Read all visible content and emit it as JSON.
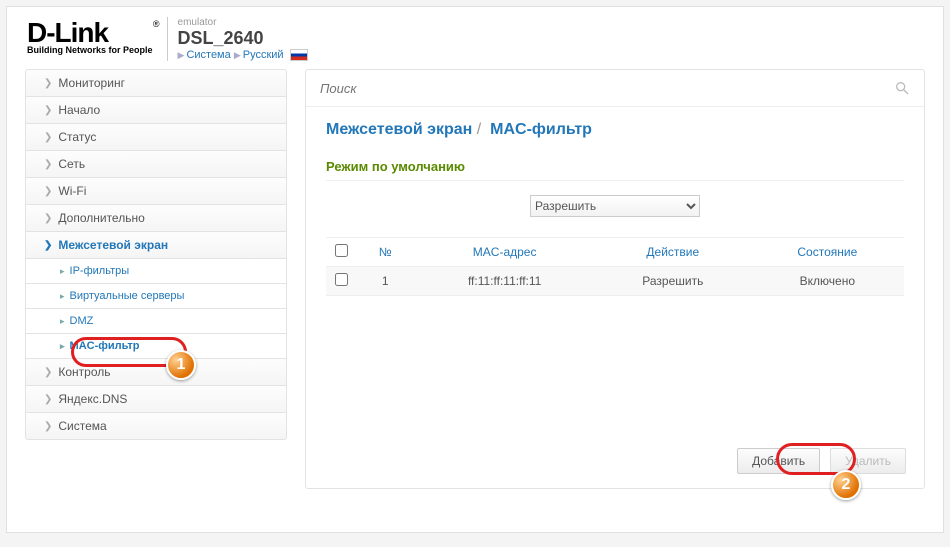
{
  "header": {
    "brand": "D-Link",
    "tagline": "Building Networks for People",
    "emulator": "emulator",
    "model": "DSL_2640",
    "crumb1": "Система",
    "crumb2": "Русский"
  },
  "sidebar": {
    "items": [
      {
        "label": "Мониторинг"
      },
      {
        "label": "Начало"
      },
      {
        "label": "Статус"
      },
      {
        "label": "Сеть"
      },
      {
        "label": "Wi-Fi"
      },
      {
        "label": "Дополнительно"
      },
      {
        "label": "Межсетевой экран",
        "expanded": true
      },
      {
        "label": "Контроль"
      },
      {
        "label": "Яндекс.DNS"
      },
      {
        "label": "Система"
      }
    ],
    "sub": [
      {
        "label": "IP-фильтры"
      },
      {
        "label": "Виртуальные серверы"
      },
      {
        "label": "DMZ"
      },
      {
        "label": "MAC-фильтр",
        "active": true
      }
    ]
  },
  "search": {
    "placeholder": "Поиск"
  },
  "title": {
    "crumb": "Межсетевой экран",
    "sep": "/",
    "page": "MAC-фильтр"
  },
  "mode": {
    "title": "Режим по умолчанию",
    "selected": "Разрешить"
  },
  "table": {
    "cols": {
      "num": "№",
      "mac": "MAC-адрес",
      "action": "Действие",
      "state": "Состояние"
    },
    "rows": [
      {
        "num": "1",
        "mac": "ff:11:ff:11:ff:11",
        "action": "Разрешить",
        "state": "Включено"
      }
    ]
  },
  "buttons": {
    "add": "Добавить",
    "del": "Удалить"
  },
  "callouts": {
    "b1": "1",
    "b2": "2"
  }
}
